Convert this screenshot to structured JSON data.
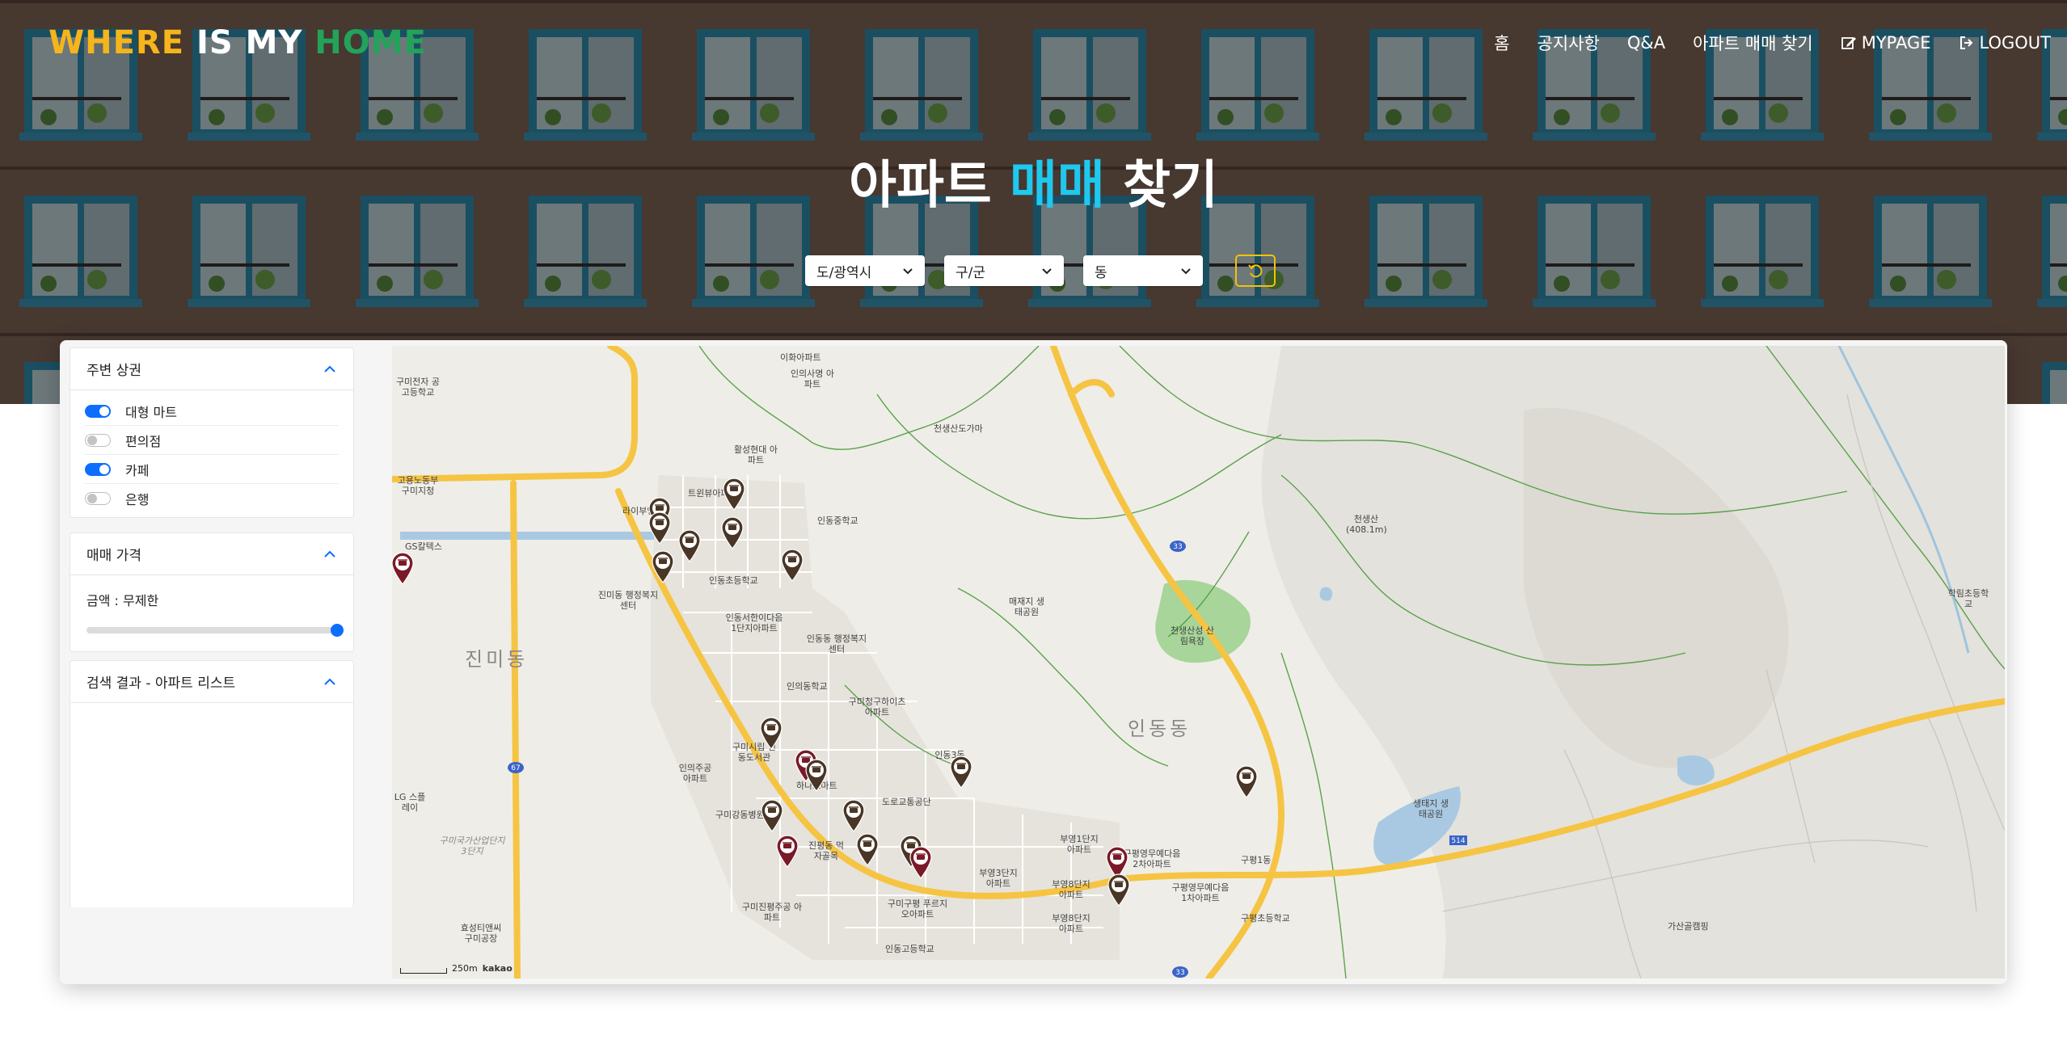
{
  "brand": {
    "word1": "WHERE",
    "word2": " IS MY ",
    "word3": "HOME"
  },
  "nav": [
    {
      "label": "홈"
    },
    {
      "label": "공지사항"
    },
    {
      "label": "Q&A"
    },
    {
      "label": "아파트 매매 찾기"
    },
    {
      "label": "MYPAGE",
      "icon": "edit-icon"
    },
    {
      "label": "LOGOUT",
      "icon": "logout-icon"
    }
  ],
  "hero": {
    "title_prefix": "아파트 ",
    "title_accent": "매매",
    "title_suffix": " 찾기"
  },
  "filters": {
    "sido": "도/광역시",
    "gugun": "구/군",
    "dong": "동",
    "reset_icon": "undo-icon"
  },
  "sidebar": {
    "nearby": {
      "title": "주변 상권",
      "items": [
        {
          "label": "대형 마트",
          "on": true
        },
        {
          "label": "편의점",
          "on": false
        },
        {
          "label": "카페",
          "on": true
        },
        {
          "label": "은행",
          "on": false
        }
      ]
    },
    "price": {
      "title": "매매 가격",
      "label": "금액 : 무제한",
      "slider_value": 1.0
    },
    "results": {
      "title": "검색 결과 - 아파트 리스트"
    }
  },
  "map": {
    "labels": [
      "이화아파트",
      "인의사명 아파트",
      "구미전자 공고등학교",
      "활성현대 아파트",
      "트윈뷰아파트",
      "고용노동부 구미지청",
      "GS칼텍스",
      "라이부영",
      "인동중학교",
      "인동초등학교",
      "진미동 행정복지센터",
      "인동서한이다음 1단지아파트",
      "인동동 행정복지센터",
      "진미동",
      "인의동학교",
      "구미청구하이츠 아파트",
      "구미시립 인동도서관",
      "인의주공 아파트",
      "LG 스플레이",
      "하나로마트",
      "도로교통공단",
      "구미강동병원",
      "진평동 먹자골목",
      "구미국가산업단지 3단지",
      "구미진평주공 아파트",
      "구미구평 푸르지오아파트",
      "인동고등학교",
      "효성티앤씨 구미공장",
      "부영1단지 아파트",
      "부영3단지 아파트",
      "부영8단지 아파트",
      "부영8단지 아파트",
      "구평영무예다음 2차아파트",
      "구평영무예다음 1차아파트",
      "구평초등학교",
      "천생산 (408.1m)",
      "천생산성 산림욕장",
      "매재지 생태공원",
      "인동동",
      "생태지 생태공원",
      "천생산도가마",
      "학림초등학교",
      "가산골캠핑",
      "구평1동",
      "인동3동"
    ],
    "road_shields": [
      "33",
      "67",
      "514",
      "33"
    ],
    "scale_text": "250m",
    "provider": "kakao"
  }
}
